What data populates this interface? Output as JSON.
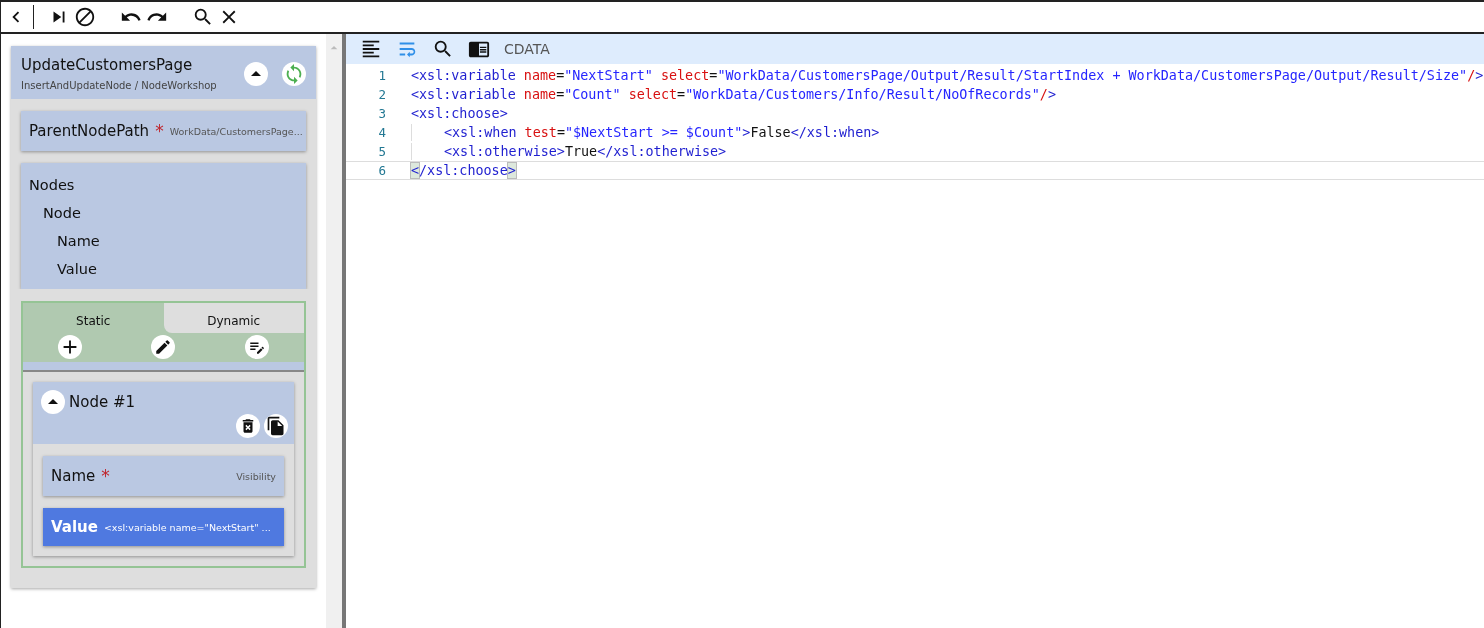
{
  "node_card": {
    "title": "UpdateCustomersPage",
    "subtitle": "InsertAndUpdateNode / NodeWorkshop",
    "expanded": true
  },
  "parent_node_path": {
    "label": "ParentNodePath",
    "required": true,
    "required_mark": "*",
    "value": "WorkData/CustomersPage..."
  },
  "nodes_tree": {
    "label": "Nodes",
    "children": [
      {
        "label": "Node",
        "children": [
          {
            "label": "Name"
          },
          {
            "label": "Value"
          }
        ]
      }
    ]
  },
  "tabs": [
    {
      "label": "Static",
      "selected": true
    },
    {
      "label": "Dynamic",
      "selected": false
    }
  ],
  "node_item": {
    "title": "Node #1",
    "expanded": true,
    "fields": [
      {
        "label": "Name",
        "required": true,
        "required_mark": "*",
        "hint": "Visibility",
        "selected": false
      },
      {
        "label": "Value",
        "required": false,
        "hint": "<xsl:variable name=\"NextStart\" ...",
        "selected": true
      }
    ]
  },
  "editor": {
    "toolbar": [
      {
        "kind": "format",
        "on": false
      },
      {
        "kind": "wrap",
        "on": true
      },
      {
        "kind": "search",
        "on": false
      },
      {
        "kind": "panel",
        "on": false
      }
    ],
    "mode_label": "CDATA",
    "lines": [
      {
        "number": "1",
        "indented": false,
        "current": false,
        "tokens": [
          {
            "kind": "tag",
            "text": "<xsl:variable"
          },
          {
            "kind": "attr",
            "text": " name"
          },
          {
            "kind": "plain",
            "text": "="
          },
          {
            "kind": "value",
            "text": "\"NextStart\""
          },
          {
            "kind": "attr",
            "text": " select"
          },
          {
            "kind": "plain",
            "text": "="
          },
          {
            "kind": "value",
            "text": "\"WorkData/CustomersPage/Output/Result/StartIndex + WorkData/CustomersPage/Output/Result/Size\""
          },
          {
            "kind": "attr",
            "text": "/"
          },
          {
            "kind": "tag",
            "text": ">"
          }
        ]
      },
      {
        "number": "2",
        "indented": false,
        "current": false,
        "tokens": [
          {
            "kind": "tag",
            "text": "<xsl:variable"
          },
          {
            "kind": "attr",
            "text": " name"
          },
          {
            "kind": "plain",
            "text": "="
          },
          {
            "kind": "value",
            "text": "\"Count\""
          },
          {
            "kind": "attr",
            "text": " select"
          },
          {
            "kind": "plain",
            "text": "="
          },
          {
            "kind": "value",
            "text": "\"WorkData/Customers/Info/Result/NoOfRecords\""
          },
          {
            "kind": "attr",
            "text": "/"
          },
          {
            "kind": "tag",
            "text": ">"
          }
        ]
      },
      {
        "number": "3",
        "indented": false,
        "current": false,
        "tokens": [
          {
            "kind": "tag",
            "text": "<xsl:choose>"
          }
        ]
      },
      {
        "number": "4",
        "indented": true,
        "current": false,
        "tokens": [
          {
            "kind": "tag",
            "text": "<xsl:when"
          },
          {
            "kind": "attr",
            "text": " test"
          },
          {
            "kind": "plain",
            "text": "="
          },
          {
            "kind": "value",
            "text": "\"$NextStart >= $Count\""
          },
          {
            "kind": "tag",
            "text": ">"
          },
          {
            "kind": "plain",
            "text": "False"
          },
          {
            "kind": "tag",
            "text": "</xsl:when>"
          }
        ]
      },
      {
        "number": "5",
        "indented": true,
        "current": false,
        "tokens": [
          {
            "kind": "tag",
            "text": "<xsl:otherwise>"
          },
          {
            "kind": "plain",
            "text": "True"
          },
          {
            "kind": "tag",
            "text": "</xsl:otherwise>"
          }
        ]
      },
      {
        "number": "6",
        "indented": false,
        "current": true,
        "tokens": [
          {
            "kind": "match",
            "text": "<"
          },
          {
            "kind": "tag",
            "text": "/xsl:choose"
          },
          {
            "kind": "match",
            "text": ">"
          }
        ]
      }
    ]
  }
}
